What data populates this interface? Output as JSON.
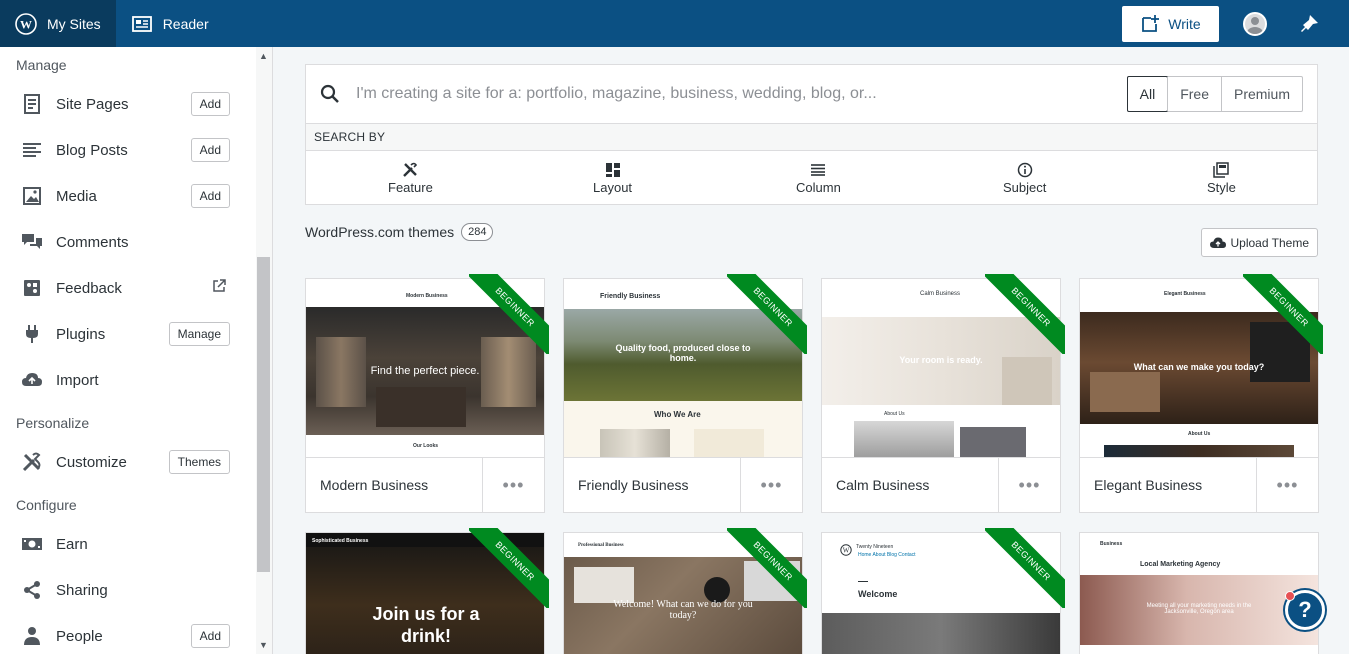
{
  "masterbar": {
    "my_sites": "My Sites",
    "reader": "Reader",
    "write": "Write"
  },
  "sidebar": {
    "sections": [
      {
        "heading": "Manage"
      },
      {
        "heading": "Personalize"
      },
      {
        "heading": "Configure"
      }
    ],
    "items": [
      {
        "label": "Site Pages",
        "button": "Add",
        "icon": "page-icon"
      },
      {
        "label": "Blog Posts",
        "button": "Add",
        "icon": "posts-icon"
      },
      {
        "label": "Media",
        "button": "Add",
        "icon": "media-icon"
      },
      {
        "label": "Comments",
        "icon": "comments-icon"
      },
      {
        "label": "Feedback",
        "icon": "feedback-icon",
        "external": "external-link-icon"
      },
      {
        "label": "Plugins",
        "button": "Manage",
        "icon": "plugins-icon"
      },
      {
        "label": "Import",
        "icon": "import-icon"
      },
      {
        "label": "Customize",
        "button": "Themes",
        "icon": "customize-icon"
      },
      {
        "label": "Earn",
        "icon": "earn-icon"
      },
      {
        "label": "Sharing",
        "icon": "sharing-icon"
      },
      {
        "label": "People",
        "button": "Add",
        "icon": "people-icon"
      }
    ]
  },
  "search": {
    "placeholder": "I'm creating a site for a: portfolio, magazine, business, wedding, blog, or...",
    "tiers": [
      "All",
      "Free",
      "Premium"
    ],
    "selected_tier": "All",
    "search_by": "SEARCH BY",
    "filters": [
      "Feature",
      "Layout",
      "Column",
      "Subject",
      "Style"
    ]
  },
  "themes": {
    "title": "WordPress.com themes",
    "count": "284",
    "upload": "Upload Theme",
    "badge": "BEGINNER",
    "cards": [
      {
        "name": "Modern Business",
        "headline": "Find the perfect piece.",
        "brand": "Modern Business",
        "section": "Our Looks"
      },
      {
        "name": "Friendly Business",
        "headline": "Quality food, produced close to home.",
        "brand": "Friendly Business",
        "section": "Who We Are"
      },
      {
        "name": "Calm Business",
        "headline": "Your room is ready.",
        "brand": "Calm Business",
        "section": "About Us"
      },
      {
        "name": "Elegant Business",
        "headline": "What can we make you today?",
        "brand": "Elegant Business",
        "section": "About Us"
      }
    ],
    "cards_row2": [
      {
        "brand": "Sophisticated Business",
        "headline": "Join us for a drink!"
      },
      {
        "brand": "Professional Business",
        "headline": "Welcome! What can we do for you today?"
      },
      {
        "brand": "Twenty Nineteen",
        "headline": "Welcome",
        "nav": "Home  About  Blog  Contact"
      },
      {
        "brand": "Business",
        "headline": "Local Marketing Agency",
        "sub": "Meeting all your marketing needs in the Jacksonville, Oregon area"
      }
    ]
  },
  "help": {
    "label": "?"
  },
  "colors": {
    "masterbar": "#0b5083",
    "ribbon": "#008a20"
  }
}
